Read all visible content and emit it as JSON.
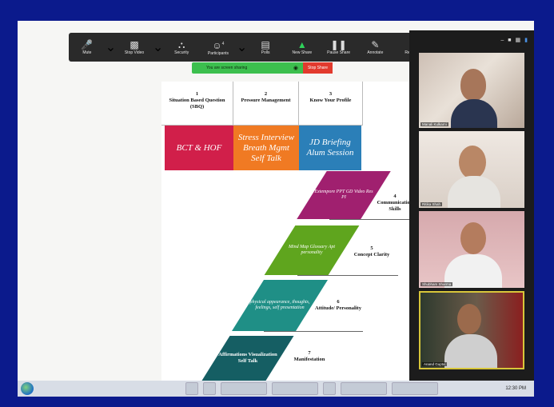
{
  "toolbar": {
    "items": [
      {
        "label": "Mute",
        "icon": "microphone-icon"
      },
      {
        "label": "Stop Video",
        "icon": "video-camera-icon"
      },
      {
        "label": "Security",
        "icon": "shield-icon"
      },
      {
        "label": "Participants",
        "icon": "participants-icon",
        "count": "4"
      },
      {
        "label": "Polls",
        "icon": "polls-icon"
      },
      {
        "label": "New Share",
        "icon": "share-screen-icon"
      },
      {
        "label": "Pause Share",
        "icon": "pause-icon"
      },
      {
        "label": "Annotate",
        "icon": "pencil-icon"
      },
      {
        "label": "Remote",
        "icon": "remote-control-icon"
      }
    ]
  },
  "share_bar": {
    "text": "You are screen sharing",
    "stop_label": "Stop Share"
  },
  "slide": {
    "headers": [
      {
        "num": "1",
        "text": "Situation Based Question (SBQ)"
      },
      {
        "num": "2",
        "text": "Pressure Management"
      },
      {
        "num": "3",
        "text": "Know Your Profile"
      }
    ],
    "boxes": [
      {
        "text": "BCT & HOF",
        "color": "#d11f4a"
      },
      {
        "text": "Stress Interview Breath Mgmt Self Talk",
        "color": "#f07a23"
      },
      {
        "text": "JD Briefing Alum Session",
        "color": "#2b7fb8"
      }
    ],
    "steps": [
      {
        "num": "4",
        "title": "Communication Skills",
        "content": "Extempore PPT GD Video Res PI",
        "color": "#a0206f"
      },
      {
        "num": "5",
        "title": "Concept Clarity",
        "content": "Mind Map Glossary Apt personality",
        "color": "#5fa51e"
      },
      {
        "num": "6",
        "title": "Attitude/ Personality",
        "content": "physical appearance, thoughts, feelings, self presentation",
        "color": "#1f8f86"
      },
      {
        "num": "7",
        "title": "Manifestation",
        "content": "Affirmations Visualization Self Talk",
        "color": "#155e63"
      }
    ]
  },
  "participants": [
    {
      "name": "Manali Kulkarni"
    },
    {
      "name": "Ritika Shah"
    },
    {
      "name": "Shubham Sharma"
    },
    {
      "name": "Anand Gupta"
    }
  ],
  "taskbar": {
    "clock": "12:30 PM"
  }
}
